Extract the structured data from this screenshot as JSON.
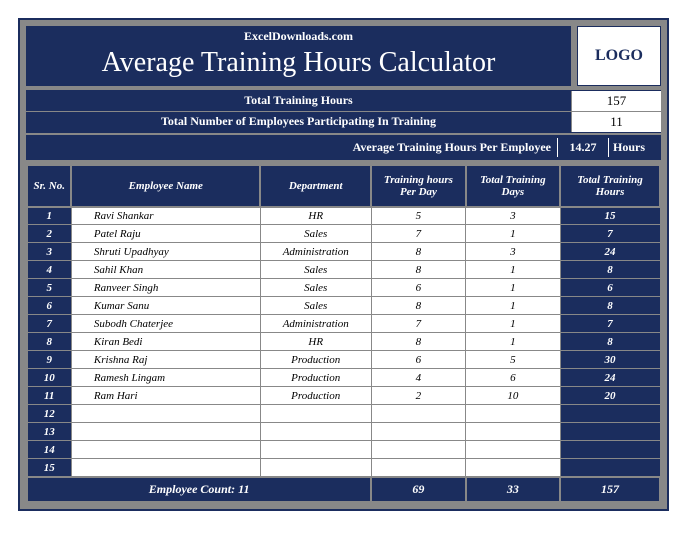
{
  "header": {
    "site": "ExcelDownloads.com",
    "title": "Average Training Hours Calculator",
    "logo": "LOGO"
  },
  "stats": {
    "total_hours_label": "Total Training Hours",
    "total_hours_value": "157",
    "total_emp_label": "Total Number of Employees Participating In Training",
    "total_emp_value": "11",
    "avg_label": "Average Training Hours Per Employee",
    "avg_value": "14.27",
    "avg_unit": "Hours"
  },
  "columns": {
    "sr": "Sr. No.",
    "name": "Employee Name",
    "dept": "Department",
    "perday": "Training hours Per Day",
    "days": "Total Training Days",
    "total": "Total Training Hours"
  },
  "rows": [
    {
      "sr": "1",
      "name": "Ravi Shankar",
      "dept": "HR",
      "perday": "5",
      "days": "3",
      "total": "15"
    },
    {
      "sr": "2",
      "name": "Patel Raju",
      "dept": "Sales",
      "perday": "7",
      "days": "1",
      "total": "7"
    },
    {
      "sr": "3",
      "name": "Shruti Upadhyay",
      "dept": "Administration",
      "perday": "8",
      "days": "3",
      "total": "24"
    },
    {
      "sr": "4",
      "name": "Sahil Khan",
      "dept": "Sales",
      "perday": "8",
      "days": "1",
      "total": "8"
    },
    {
      "sr": "5",
      "name": "Ranveer Singh",
      "dept": "Sales",
      "perday": "6",
      "days": "1",
      "total": "6"
    },
    {
      "sr": "6",
      "name": "Kumar Sanu",
      "dept": "Sales",
      "perday": "8",
      "days": "1",
      "total": "8"
    },
    {
      "sr": "7",
      "name": "Subodh Chaterjee",
      "dept": "Administration",
      "perday": "7",
      "days": "1",
      "total": "7"
    },
    {
      "sr": "8",
      "name": "Kiran Bedi",
      "dept": "HR",
      "perday": "8",
      "days": "1",
      "total": "8"
    },
    {
      "sr": "9",
      "name": "Krishna Raj",
      "dept": "Production",
      "perday": "6",
      "days": "5",
      "total": "30"
    },
    {
      "sr": "10",
      "name": "Ramesh Lingam",
      "dept": "Production",
      "perday": "4",
      "days": "6",
      "total": "24"
    },
    {
      "sr": "11",
      "name": "Ram Hari",
      "dept": "Production",
      "perday": "2",
      "days": "10",
      "total": "20"
    },
    {
      "sr": "12",
      "name": "",
      "dept": "",
      "perday": "",
      "days": "",
      "total": ""
    },
    {
      "sr": "13",
      "name": "",
      "dept": "",
      "perday": "",
      "days": "",
      "total": ""
    },
    {
      "sr": "14",
      "name": "",
      "dept": "",
      "perday": "",
      "days": "",
      "total": ""
    },
    {
      "sr": "15",
      "name": "",
      "dept": "",
      "perday": "",
      "days": "",
      "total": ""
    }
  ],
  "footer": {
    "emp_count": "Employee Count: 11",
    "sum_perday": "69",
    "sum_days": "33",
    "sum_total": "157"
  },
  "chart_data": {
    "type": "table",
    "title": "Average Training Hours Calculator",
    "columns": [
      "Sr. No.",
      "Employee Name",
      "Department",
      "Training hours Per Day",
      "Total Training Days",
      "Total Training Hours"
    ],
    "data": [
      [
        1,
        "Ravi Shankar",
        "HR",
        5,
        3,
        15
      ],
      [
        2,
        "Patel Raju",
        "Sales",
        7,
        1,
        7
      ],
      [
        3,
        "Shruti Upadhyay",
        "Administration",
        8,
        3,
        24
      ],
      [
        4,
        "Sahil Khan",
        "Sales",
        8,
        1,
        8
      ],
      [
        5,
        "Ranveer Singh",
        "Sales",
        6,
        1,
        6
      ],
      [
        6,
        "Kumar Sanu",
        "Sales",
        8,
        1,
        8
      ],
      [
        7,
        "Subodh Chaterjee",
        "Administration",
        7,
        1,
        7
      ],
      [
        8,
        "Kiran Bedi",
        "HR",
        8,
        1,
        8
      ],
      [
        9,
        "Krishna Raj",
        "Production",
        6,
        5,
        30
      ],
      [
        10,
        "Ramesh Lingam",
        "Production",
        4,
        6,
        24
      ],
      [
        11,
        "Ram Hari",
        "Production",
        2,
        10,
        20
      ]
    ],
    "totals": {
      "perday": 69,
      "days": 33,
      "total_hours": 157,
      "employee_count": 11,
      "avg_per_employee": 14.27
    }
  }
}
